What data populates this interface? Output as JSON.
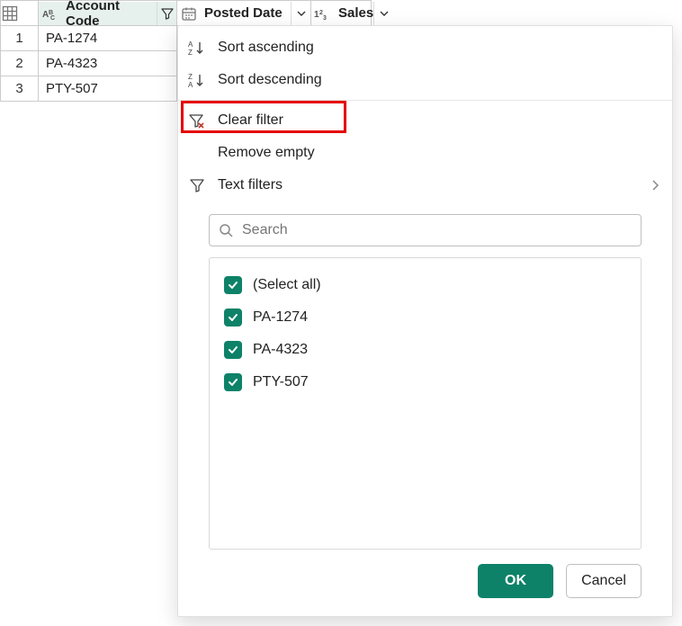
{
  "columns": {
    "account_code": {
      "label": "Account Code"
    },
    "posted_date": {
      "label": "Posted Date"
    },
    "sales": {
      "label": "Sales"
    }
  },
  "rows": [
    {
      "n": "1",
      "account_code": "PA-1274"
    },
    {
      "n": "2",
      "account_code": "PA-4323"
    },
    {
      "n": "3",
      "account_code": "PTY-507"
    }
  ],
  "menu": {
    "sort_asc": "Sort ascending",
    "sort_desc": "Sort descending",
    "clear_filter": "Clear filter",
    "remove_empty": "Remove empty",
    "text_filters": "Text filters"
  },
  "search": {
    "placeholder": "Search"
  },
  "filter_options": [
    {
      "label": "(Select all)",
      "checked": true
    },
    {
      "label": "PA-1274",
      "checked": true
    },
    {
      "label": "PA-4323",
      "checked": true
    },
    {
      "label": "PTY-507",
      "checked": true
    }
  ],
  "buttons": {
    "ok": "OK",
    "cancel": "Cancel"
  }
}
